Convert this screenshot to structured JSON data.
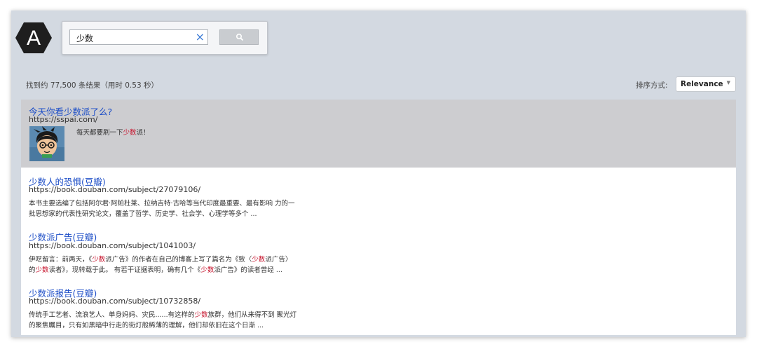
{
  "app": {
    "logo_letter": "A"
  },
  "search": {
    "query": "少数",
    "clear_icon": "×"
  },
  "results_info": {
    "count_text": "找到约 77,500 条结果（用时 0.53 秒）"
  },
  "sort": {
    "label": "排序方式:",
    "value": "Relevance",
    "chevron": "▼"
  },
  "colors": {
    "link": "#1d4ec7",
    "highlight": "#c6122b",
    "window_bg": "#d3d9e1"
  },
  "results": [
    {
      "title": "今天你看少数派了么?",
      "url": "https://sspai.com/",
      "has_thumbnail": true,
      "snippet": {
        "a": "每天都要刷一下",
        "hl": "少数",
        "b": "派！"
      }
    },
    {
      "title": "少数人的恐惧(豆瓣)",
      "url": "https://book.douban.com/subject/27079106/",
      "line1": "本书主要选编了包括阿尔君·阿帕杜莱、拉纳吉特·古哈等当代印度最重要、最有影响 力的一",
      "line2": "批思想家的代表性研究论文，覆盖了哲学、历史学、社会学、心理学等多个 ..."
    },
    {
      "title": "少数派广告(豆瓣)",
      "url": "https://book.douban.com/subject/1041003/",
      "line1": {
        "a": "伊呓留言：前两天，《",
        "hl1": "少数",
        "b": "派广告》的作者在自己的博客上写了篇名为《致〈",
        "hl2": "少数",
        "c": "派广告〉"
      },
      "line2": {
        "a": "的",
        "hl1": "少数",
        "b": "读者》，现转载于此。 有若干证据表明，确有几个《",
        "hl2": "少数",
        "c": "派广告》的读者曾经 ..."
      }
    },
    {
      "title": "少数派报告(豆瓣)",
      "url": "https://book.douban.com/subject/10732858/",
      "line1": {
        "a": "传统手工艺者、流浪艺人、单身妈妈、灾民......有这样的",
        "hl": "少数",
        "b": "族群，他们从来得不到 聚光灯"
      },
      "line2": "的聚焦瞩目，只有如黑暗中行走的街灯般稀薄的理解，他们却依旧在这个日渐  ..."
    }
  ]
}
